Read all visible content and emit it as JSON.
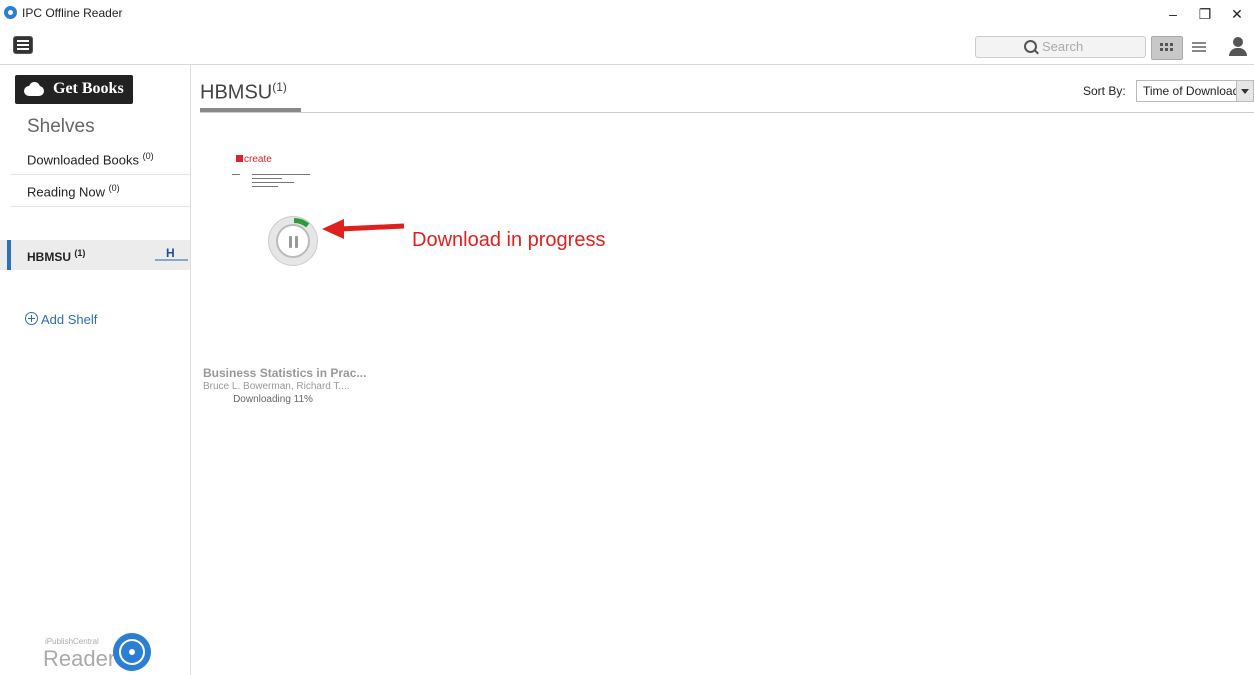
{
  "window": {
    "title": "IPC Offline Reader",
    "controls": {
      "minimize": "–",
      "restore": "❐",
      "close": "✕"
    }
  },
  "toolbar": {
    "search_placeholder": "Search",
    "icons": [
      "menu-icon",
      "search-icon",
      "grid-view-icon",
      "list-view-icon",
      "user-icon"
    ]
  },
  "sidebar": {
    "get_books_label": "Get Books",
    "shelves_title": "Shelves",
    "items": [
      {
        "label": "Downloaded Books",
        "count": "(0)"
      },
      {
        "label": "Reading Now",
        "count": "(0)"
      }
    ],
    "shelves": [
      {
        "label": "HBMSU",
        "count": "(1)",
        "logo_text": "H"
      }
    ],
    "add_shelf_label": "Add Shelf",
    "brand_small": "iPublishCentral",
    "brand_big": "Reader"
  },
  "main": {
    "shelf_name": "HBMSU",
    "shelf_count": "(1)",
    "sort_label": "Sort By:",
    "sort_value": "Time of Download",
    "books": [
      {
        "cover_brand": "create",
        "title": "Business Statistics in Prac...",
        "author": "Bruce L. Bowerman, Richard T....",
        "status": "Downloading 11%",
        "progress_percent": 11
      }
    ],
    "annotation": "Download in progress"
  },
  "colors": {
    "accent": "#2f6fb5",
    "annotation": "#e0201f",
    "progress": "#2e9a3a"
  }
}
